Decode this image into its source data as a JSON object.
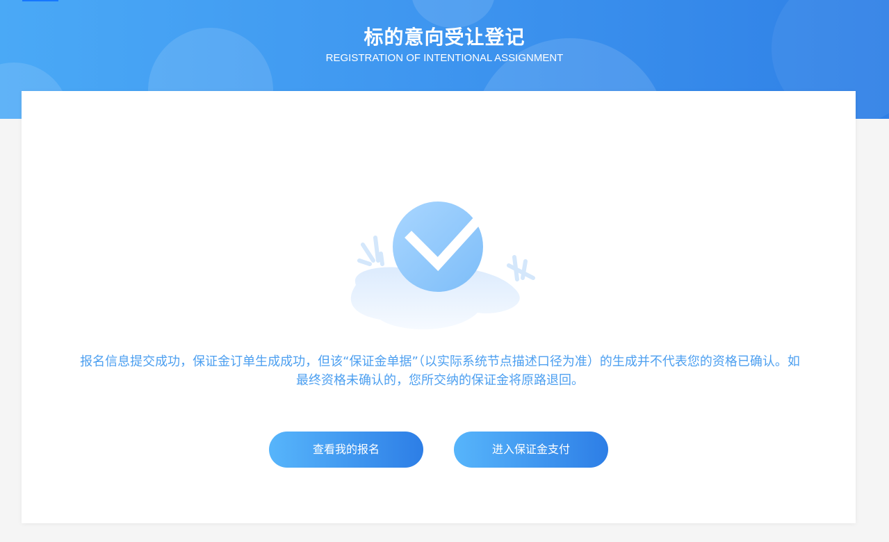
{
  "header": {
    "title": "标的意向受让登记",
    "subtitle": "REGISTRATION OF INTENTIONAL ASSIGNMENT"
  },
  "result": {
    "icon": "success-check-icon",
    "message": "报名信息提交成功，保证金订单生成成功，但该“保证金单据”（以实际系统节点描述口径为准）的生成并不代表您的资格已确认。如最终资格未确认的，您所交纳的保证金将原路退回。"
  },
  "actions": {
    "view_registration_label": "查看我的报名",
    "pay_deposit_label": "进入保证金支付"
  },
  "colors": {
    "header_gradient_start": "#4aa9f6",
    "header_gradient_end": "#2f80e6",
    "message_text": "#4c9ff0",
    "button_gradient_start": "#57b5fb",
    "button_gradient_end": "#2d7ee6"
  }
}
